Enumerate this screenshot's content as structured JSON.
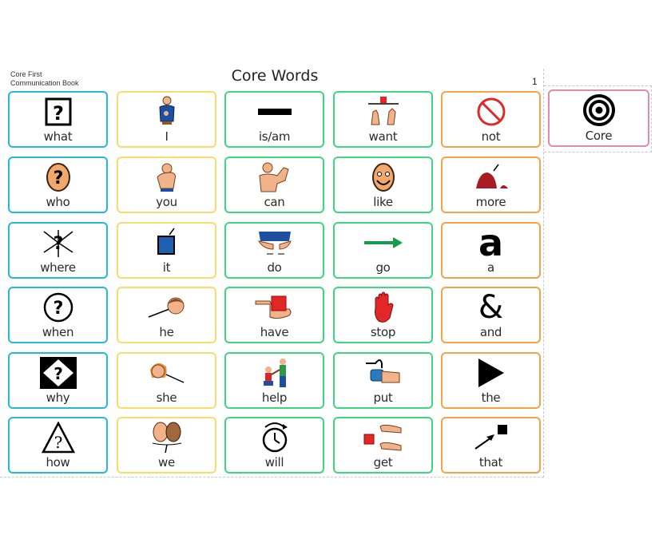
{
  "header": {
    "book_title_line1": "Core First",
    "book_title_line2": "Communication Book",
    "page_title": "Core Words",
    "page_number": "1"
  },
  "colors": {
    "question": "#27b6dc",
    "pronoun": "#f8dc6e",
    "verb": "#3ed67f",
    "little_word": "#f5a24a",
    "tab": "#e48aae"
  },
  "tab": {
    "label": "Core",
    "icon": "target-icon"
  },
  "grid": {
    "rows": [
      [
        {
          "label": "what",
          "icon": "question-box-icon",
          "category": "question"
        },
        {
          "label": "I",
          "icon": "person-self-icon",
          "category": "pronoun"
        },
        {
          "label": "is/am",
          "icon": "dash-bar-icon",
          "category": "verb"
        },
        {
          "label": "want",
          "icon": "want-hands-icon",
          "category": "verb"
        },
        {
          "label": "not",
          "icon": "prohibited-icon",
          "category": "little_word"
        }
      ],
      [
        {
          "label": "who",
          "icon": "question-head-icon",
          "category": "question"
        },
        {
          "label": "you",
          "icon": "pointing-person-icon",
          "category": "pronoun"
        },
        {
          "label": "can",
          "icon": "flexing-arm-icon",
          "category": "verb"
        },
        {
          "label": "like",
          "icon": "smiling-face-icon",
          "category": "verb"
        },
        {
          "label": "more",
          "icon": "more-pile-icon",
          "category": "little_word"
        }
      ],
      [
        {
          "label": "where",
          "icon": "question-arrows-icon",
          "category": "question"
        },
        {
          "label": "it",
          "icon": "arrow-to-square-icon",
          "category": "pronoun"
        },
        {
          "label": "do",
          "icon": "hands-doing-icon",
          "category": "verb"
        },
        {
          "label": "go",
          "icon": "right-arrow-icon",
          "category": "verb"
        },
        {
          "label": "a",
          "icon": "letter-a-icon",
          "category": "little_word"
        }
      ],
      [
        {
          "label": "when",
          "icon": "question-clock-icon",
          "category": "question"
        },
        {
          "label": "he",
          "icon": "arrow-to-boy-icon",
          "category": "pronoun"
        },
        {
          "label": "have",
          "icon": "hands-holding-box-icon",
          "category": "verb"
        },
        {
          "label": "stop",
          "icon": "stop-hand-icon",
          "category": "verb"
        },
        {
          "label": "and",
          "icon": "ampersand-icon",
          "category": "little_word"
        }
      ],
      [
        {
          "label": "why",
          "icon": "question-diamond-icon",
          "category": "question"
        },
        {
          "label": "she",
          "icon": "girl-arrow-icon",
          "category": "pronoun"
        },
        {
          "label": "help",
          "icon": "helping-people-icon",
          "category": "verb"
        },
        {
          "label": "put",
          "icon": "hand-putting-icon",
          "category": "verb"
        },
        {
          "label": "the",
          "icon": "play-triangle-icon",
          "category": "little_word"
        }
      ],
      [
        {
          "label": "how",
          "icon": "question-triangle-icon",
          "category": "question"
        },
        {
          "label": "we",
          "icon": "two-faces-icon",
          "category": "pronoun"
        },
        {
          "label": "will",
          "icon": "future-clock-icon",
          "category": "verb"
        },
        {
          "label": "get",
          "icon": "hands-getting-icon",
          "category": "verb"
        },
        {
          "label": "that",
          "icon": "arrow-to-black-square-icon",
          "category": "little_word"
        }
      ]
    ]
  }
}
